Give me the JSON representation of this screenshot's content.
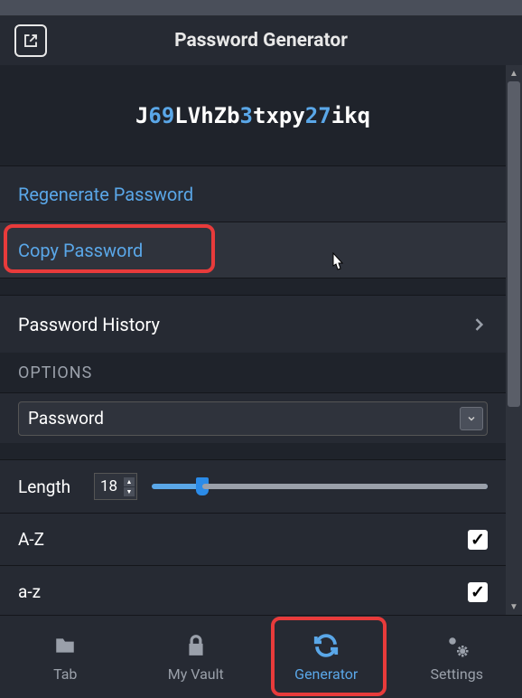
{
  "header": {
    "title": "Password Generator"
  },
  "password": {
    "segments": [
      {
        "t": "J",
        "c": "letter"
      },
      {
        "t": "69",
        "c": "digit"
      },
      {
        "t": "LVhZb",
        "c": "letter"
      },
      {
        "t": "3",
        "c": "digit"
      },
      {
        "t": "txpy",
        "c": "letter"
      },
      {
        "t": "27",
        "c": "digit"
      },
      {
        "t": "ikq",
        "c": "letter"
      }
    ]
  },
  "actions": {
    "regenerate": "Regenerate Password",
    "copy": "Copy Password",
    "history": "Password History"
  },
  "options": {
    "header": "OPTIONS",
    "type_label": "Password",
    "length_label": "Length",
    "length_value": "18",
    "checks": [
      {
        "label": "A-Z",
        "checked": true
      },
      {
        "label": "a-z",
        "checked": true
      }
    ]
  },
  "nav": {
    "items": [
      {
        "label": "Tab",
        "icon": "folder"
      },
      {
        "label": "My Vault",
        "icon": "lock"
      },
      {
        "label": "Generator",
        "icon": "refresh",
        "active": true
      },
      {
        "label": "Settings",
        "icon": "gears"
      }
    ]
  }
}
